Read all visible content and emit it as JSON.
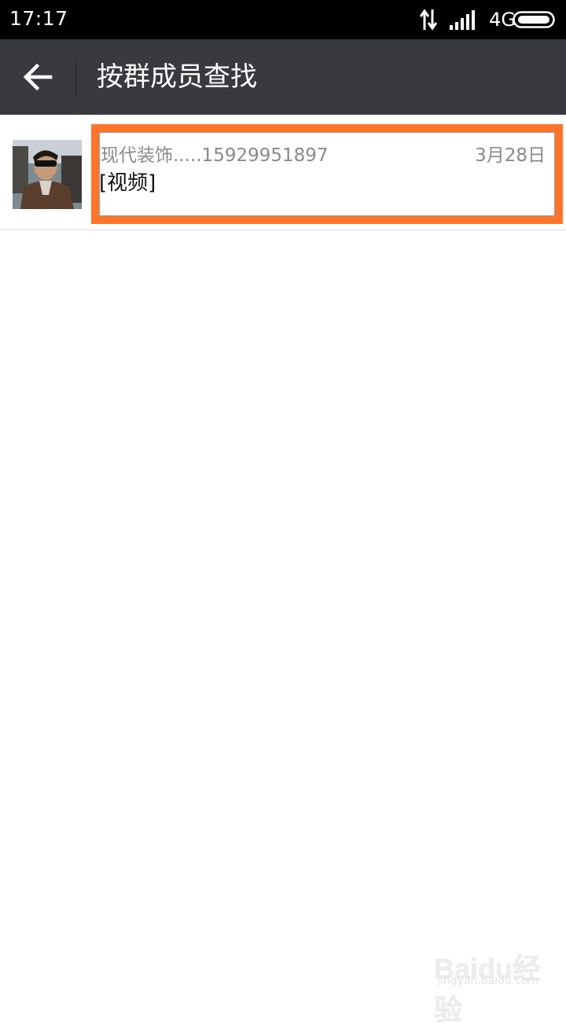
{
  "status_bar": {
    "time": "17:17",
    "network": "4G",
    "icons": [
      "data-transfer-icon",
      "signal-icon",
      "battery-icon"
    ]
  },
  "header": {
    "title": "按群成员查找",
    "back_icon": "arrow-left-icon",
    "background": "#393a3f"
  },
  "results": [
    {
      "sender": "现代装饰.....15929951897",
      "date": "3月28日",
      "preview": "[视频]"
    }
  ],
  "highlight_color": "#ff7428",
  "watermark": {
    "brand": "Baidu经验",
    "url": "jingyan.baidu.com"
  }
}
